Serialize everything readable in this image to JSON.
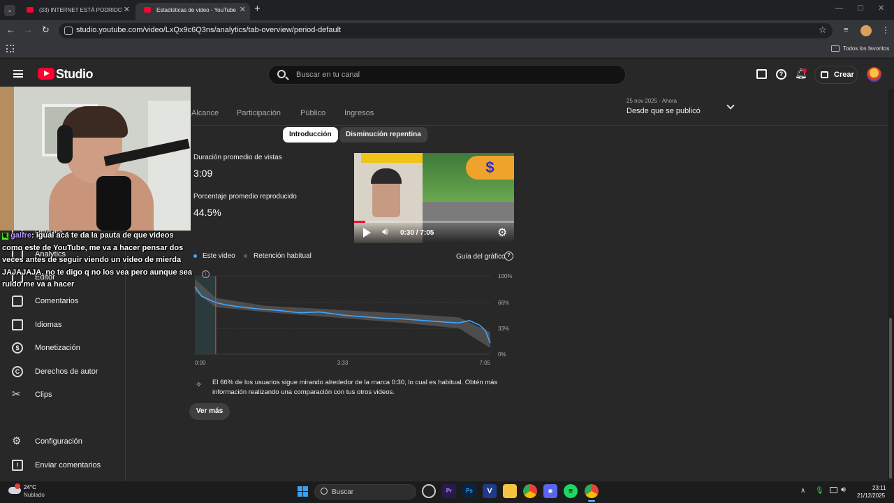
{
  "browser": {
    "tabs": [
      {
        "title": "(33) INTERNET ESTÁ PODRIDO - YouTube",
        "active": false
      },
      {
        "title": "Estadísticas de video - YouTube Studio",
        "active": true
      }
    ],
    "url": "studio.youtube.com/video/LxQx9c6Q3ns/analytics/tab-overview/period-default",
    "bookmarks_all": "Todos los favoritos"
  },
  "studio": {
    "logo_text": "Studio",
    "search_placeholder": "Buscar en tu canal",
    "create_label": "Crear"
  },
  "sidebar": {
    "items": [
      {
        "label": "Detalles",
        "icon": "pencil-icon"
      },
      {
        "label": "Analytics",
        "icon": "chart-icon"
      },
      {
        "label": "Editor",
        "icon": "film-icon"
      },
      {
        "label": "Comentarios",
        "icon": "comment-icon"
      },
      {
        "label": "Idiomas",
        "icon": "subtitles-icon"
      },
      {
        "label": "Monetización",
        "icon": "dollar-icon"
      },
      {
        "label": "Derechos de autor",
        "icon": "copyright-icon"
      },
      {
        "label": "Clips",
        "icon": "scissors-icon"
      },
      {
        "label": "Configuración",
        "icon": "gear-icon"
      },
      {
        "label": "Enviar comentarios",
        "icon": "feedback-icon"
      }
    ]
  },
  "analytics": {
    "tabs": [
      "Alcance",
      "Participación",
      "Público",
      "Ingresos"
    ],
    "period_range": "25 nov 2025 - Ahora",
    "period_label": "Desde que se publicó",
    "chips": [
      "Introducción",
      "Disminución repentina"
    ],
    "avg_view_duration_label": "Duración promedio de vistas",
    "avg_view_duration_value": "3:09",
    "avg_pct_label": "Porcentaje promedio reproducido",
    "avg_pct_value": "44.5%",
    "player_time": "0:30 / 7:05",
    "player_progress": 0.07,
    "legend_this": "Este video",
    "legend_typical": "Retención habitual",
    "chart_guide": "Guía del gráfico",
    "insight": "El 66% de los usuarios sigue mirando alrededor de la marca 0:30, lo cual es habitual. Obtén más información realizando una comparación con tus otros videos.",
    "see_more": "Ver más"
  },
  "chart_data": {
    "type": "line",
    "title": "",
    "xlabel": "",
    "ylabel": "",
    "x_ticks": [
      "0:00",
      "3:33",
      "7:05"
    ],
    "y_ticks": [
      "100%",
      "66%",
      "33%",
      "0%"
    ],
    "ylim": [
      0,
      100
    ],
    "xlim_seconds": [
      0,
      425
    ],
    "marker_seconds": 30,
    "series": [
      {
        "name": "Este video",
        "color": "#3ea6ff",
        "x": [
          0,
          10,
          20,
          30,
          45,
          60,
          90,
          120,
          150,
          180,
          213,
          240,
          270,
          300,
          330,
          360,
          380,
          395,
          410,
          418,
          425
        ],
        "y": [
          86,
          74,
          70,
          66,
          63,
          61,
          58,
          56,
          53,
          54,
          50,
          48,
          46,
          45,
          43,
          41,
          40,
          43,
          37,
          30,
          14
        ]
      },
      {
        "name": "Retención habitual",
        "color": "#5a5a5a",
        "x": [
          0,
          30,
          100,
          200,
          300,
          380,
          425
        ],
        "y_upper": [
          96,
          72,
          62,
          57,
          52,
          47,
          28
        ],
        "y_lower": [
          80,
          60,
          54,
          47,
          40,
          33,
          8
        ]
      }
    ]
  },
  "stream_overlay": {
    "chat_user": "galfre",
    "chat_message": ": igual acá te da la pauta de que videos como este de YouTube, me va a hacer pensar dos veces antes de seguir viendo un video de mierda JAJAJAJA. no te digo q no los vea pero aunque sea ruido me va a hacer"
  },
  "taskbar": {
    "weather_temp": "24°C",
    "weather_desc": "Nublado",
    "search_label": "Buscar",
    "time": "23:11",
    "date": "21/12/2025"
  }
}
